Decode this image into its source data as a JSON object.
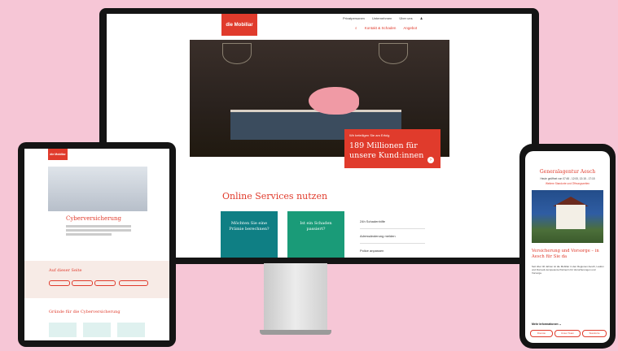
{
  "desktop": {
    "logo": "die Mobiliar",
    "topnav": [
      "Privatpersonen",
      "Unternehmen",
      "Über uns"
    ],
    "nav": [
      "Kontakt & Schaden",
      "Angebot"
    ],
    "promo": {
      "kicker": "Wir beteiligen Sie am Erfolg",
      "headline": "189 Millionen für unsere Kund:innen",
      "arrow": "›"
    },
    "online_title": "Online Services nutzen",
    "cards": [
      {
        "text": "Möchten Sie eine Prämie berechnen?",
        "color": "#0f7f84"
      },
      {
        "text": "Ist ein Schaden passiert?",
        "color": "#1a9b78"
      }
    ],
    "side_list": [
      "24h Schadenhilfe",
      "Adressänderung melden",
      "Police anpassen"
    ]
  },
  "tablet": {
    "logo": "die Mobiliar",
    "title": "Cyberversicherung",
    "subtitle": "Auf dieser Seite",
    "section": "Gründe für die Cyberversicherung"
  },
  "phone": {
    "title": "Generalagentur Aesch",
    "hours": "Heute geöffnet von 07:45 - 12:00, 13:15 - 17:15",
    "hours_link": "Weitere Standorte und Öffnungszeiten",
    "subtitle": "Versicherung und Vorsorge – in Aesch für Sie da",
    "para": "Seit über 40 Jahren ist die Mobiliar in den Regionen Aesch, Laufen und Dorneck kompetente Partnerin für Versicherungen und Vorsorge.",
    "more": "Mehr Informationen",
    "pills": [
      "Dienste",
      "Unser Team",
      "Standorte"
    ]
  },
  "colors": {
    "brand": "#e03b2c",
    "background": "#f6c6d6"
  }
}
